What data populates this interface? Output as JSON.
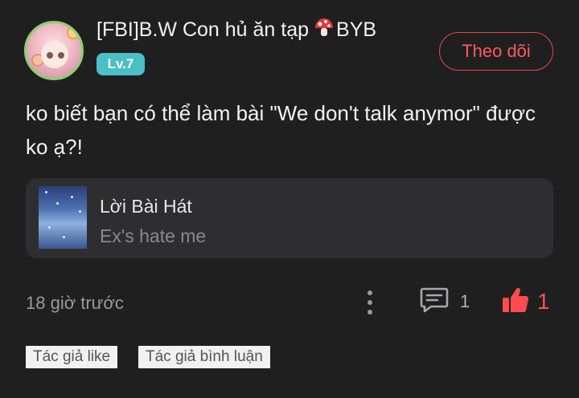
{
  "post": {
    "author": {
      "name": "[FBI]B.W Con hủ ăn tạp",
      "name_suffix": "BYB",
      "level": "Lv.7"
    },
    "follow_label": "Theo dõi",
    "text": "ko biết bạn có thể làm bài \"We don't talk anymor\" được ko ạ?!",
    "song": {
      "title": "Lời Bài Hát",
      "artist": "Ex's hate me"
    },
    "timestamp": "18 giờ trước",
    "comment_count": "1",
    "like_count": "1",
    "tags": [
      "Tác giả like",
      "Tác giả bình luận"
    ]
  },
  "colors": {
    "background": "#1f1f20",
    "accent_red": "#ff4d4f",
    "level_badge": "#4bbfc6",
    "card": "#2e2e30"
  },
  "icons": [
    "mushroom-icon",
    "more-vertical-icon",
    "comment-icon",
    "thumbs-up-icon"
  ]
}
